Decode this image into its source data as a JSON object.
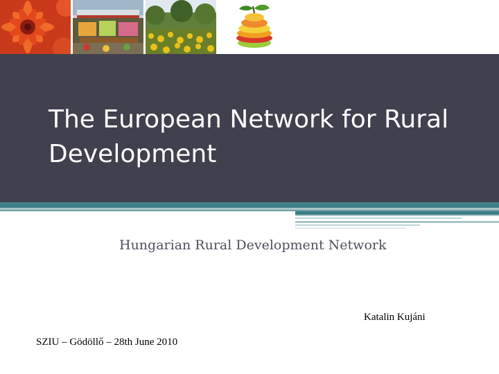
{
  "photos": [
    {
      "name": "red-dahlia-flower-photo"
    },
    {
      "name": "market-stall-photo"
    },
    {
      "name": "yellow-flower-field-photo"
    },
    {
      "name": "sliced-fruit-stack-photo"
    }
  ],
  "title": "The European Network for Rural Development",
  "subtitle": "Hungarian Rural Development Network",
  "author": "Katalin Kujáni",
  "event_line": "SZIU – Gödöllő – 28th June 2010",
  "colors": {
    "title_band": "#41404f",
    "stripe_teal": "#3d8087",
    "stripe_light": "#a9c5c9",
    "subtitle_text": "#4f4e5e"
  }
}
